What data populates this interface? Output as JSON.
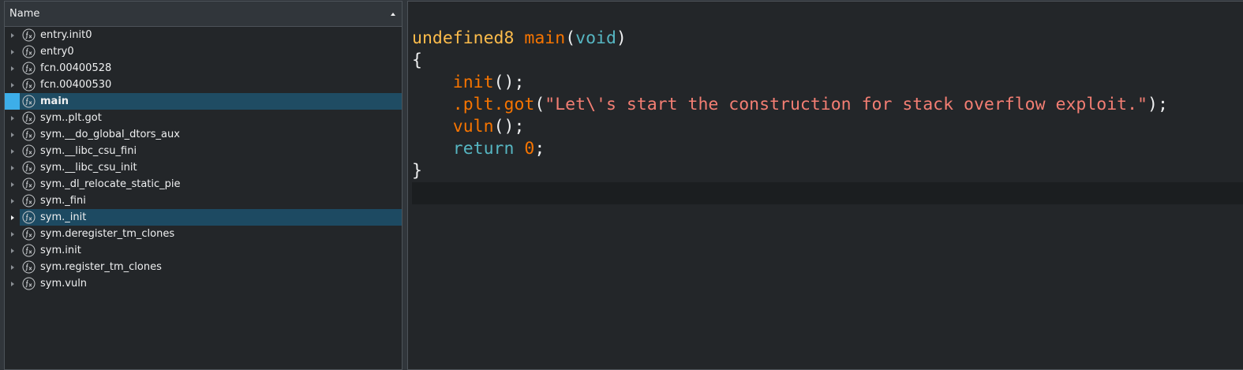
{
  "function_list": {
    "header": "Name",
    "items": [
      {
        "label": "entry.init0",
        "state": "normal"
      },
      {
        "label": "entry0",
        "state": "normal"
      },
      {
        "label": "fcn.00400528",
        "state": "normal"
      },
      {
        "label": "fcn.00400530",
        "state": "normal"
      },
      {
        "label": "main",
        "state": "current"
      },
      {
        "label": "sym..plt.got",
        "state": "normal"
      },
      {
        "label": "sym.__do_global_dtors_aux",
        "state": "normal"
      },
      {
        "label": "sym.__libc_csu_fini",
        "state": "normal"
      },
      {
        "label": "sym.__libc_csu_init",
        "state": "normal"
      },
      {
        "label": "sym._dl_relocate_static_pie",
        "state": "normal"
      },
      {
        "label": "sym._fini",
        "state": "normal"
      },
      {
        "label": "sym._init",
        "state": "selected"
      },
      {
        "label": "sym.deregister_tm_clones",
        "state": "normal"
      },
      {
        "label": "sym.init",
        "state": "normal"
      },
      {
        "label": "sym.register_tm_clones",
        "state": "normal"
      },
      {
        "label": "sym.vuln",
        "state": "normal"
      }
    ]
  },
  "decompiler": {
    "lines": [
      [
        {
          "t": "undefined8",
          "k": "type"
        },
        {
          "t": " ",
          "k": "punct"
        },
        {
          "t": "main",
          "k": "fn"
        },
        {
          "t": "(",
          "k": "punct"
        },
        {
          "t": "void",
          "k": "kw"
        },
        {
          "t": ")",
          "k": "punct"
        }
      ],
      [
        {
          "t": "{",
          "k": "punct"
        }
      ],
      [
        {
          "t": "    ",
          "k": "punct"
        },
        {
          "t": "init",
          "k": "fn"
        },
        {
          "t": "();",
          "k": "punct"
        }
      ],
      [
        {
          "t": "    ",
          "k": "punct"
        },
        {
          "t": ".plt.got",
          "k": "fn"
        },
        {
          "t": "(",
          "k": "punct"
        },
        {
          "t": "\"Let\\'s start the construction for stack overflow exploit.\"",
          "k": "str"
        },
        {
          "t": ");",
          "k": "punct"
        }
      ],
      [
        {
          "t": "    ",
          "k": "punct"
        },
        {
          "t": "vuln",
          "k": "fn"
        },
        {
          "t": "();",
          "k": "punct"
        }
      ],
      [
        {
          "t": "    ",
          "k": "punct"
        },
        {
          "t": "return",
          "k": "kw"
        },
        {
          "t": " ",
          "k": "punct"
        },
        {
          "t": "0",
          "k": "num"
        },
        {
          "t": ";",
          "k": "punct"
        }
      ],
      [
        {
          "t": "}",
          "k": "punct"
        }
      ],
      []
    ],
    "cursor_line": 7
  },
  "colors": {
    "background": "#232629",
    "selection": "#1d4a62",
    "accent": "#3daee9",
    "type": "#fdbc4b",
    "function": "#f67400",
    "keyword": "#56b6c2",
    "string": "#f37e73"
  },
  "icons": {
    "function_item": "function-icon"
  }
}
